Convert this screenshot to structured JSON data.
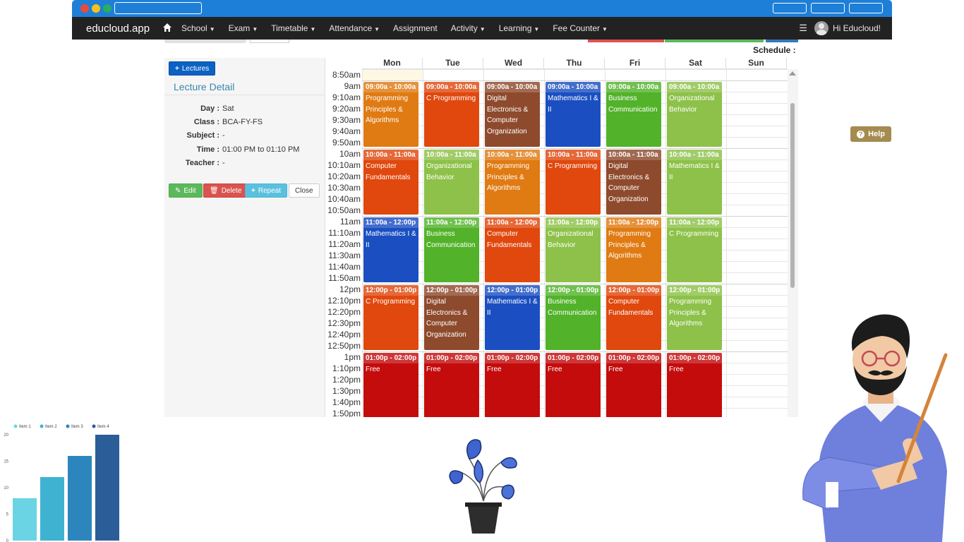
{
  "app": {
    "brand": "educloud.app",
    "nav": [
      {
        "label": "School",
        "dropdown": true
      },
      {
        "label": "Exam",
        "dropdown": true
      },
      {
        "label": "Timetable",
        "dropdown": true
      },
      {
        "label": "Attendance",
        "dropdown": true
      },
      {
        "label": "Assignment",
        "dropdown": false
      },
      {
        "label": "Activity",
        "dropdown": true
      },
      {
        "label": "Learning",
        "dropdown": true
      },
      {
        "label": "Fee Counter",
        "dropdown": true
      }
    ],
    "user_greeting": "Hi Educloud!"
  },
  "page": {
    "schedule_label": "Schedule :",
    "lectures_button": "Lectures",
    "detail_title": "Lecture Detail",
    "detail": [
      {
        "label": "Day :",
        "value": "Sat"
      },
      {
        "label": "Class :",
        "value": "BCA-FY-FS"
      },
      {
        "label": "Subject :",
        "value": "-"
      },
      {
        "label": "Time :",
        "value": "01:00 PM to 01:10 PM"
      },
      {
        "label": "Teacher :",
        "value": "-"
      }
    ],
    "buttons": {
      "edit": "Edit",
      "delete": "Delete",
      "repeat": "Repeat",
      "close": "Close"
    },
    "help": "Help"
  },
  "calendar": {
    "days": [
      "Mon",
      "Tue",
      "Wed",
      "Thu",
      "Fri",
      "Sat",
      "Sun"
    ],
    "times": [
      "8:50am",
      "9am",
      "9:10am",
      "9:20am",
      "9:30am",
      "9:40am",
      "9:50am",
      "10am",
      "10:10am",
      "10:20am",
      "10:30am",
      "10:40am",
      "10:50am",
      "11am",
      "11:10am",
      "11:20am",
      "11:30am",
      "11:40am",
      "11:50am",
      "12pm",
      "12:10pm",
      "12:20pm",
      "12:30pm",
      "12:40pm",
      "12:50pm",
      "1pm",
      "1:10pm",
      "1:20pm",
      "1:30pm",
      "1:40pm",
      "1:50pm"
    ],
    "slot_times": [
      "09:00a - 10:00a",
      "10:00a - 11:00a",
      "11:00a - 12:00p",
      "12:00p - 01:00p",
      "01:00p - 02:00p"
    ],
    "events": [
      {
        "day": 0,
        "slot": 0,
        "title": "Programming Principles & Algorithms",
        "color": "#e07a12"
      },
      {
        "day": 1,
        "slot": 0,
        "title": "C Programming",
        "color": "#e0480e"
      },
      {
        "day": 2,
        "slot": 0,
        "title": "Digital Electronics & Computer Organization",
        "color": "#8e4a2c"
      },
      {
        "day": 3,
        "slot": 0,
        "title": "Mathematics I & II",
        "color": "#1b4fc1"
      },
      {
        "day": 4,
        "slot": 0,
        "title": "Business Communication",
        "color": "#52b22a"
      },
      {
        "day": 5,
        "slot": 0,
        "title": "Organizational Behavior",
        "color": "#8dc149"
      },
      {
        "day": 0,
        "slot": 1,
        "title": "Computer Fundamentals",
        "color": "#e0480e"
      },
      {
        "day": 1,
        "slot": 1,
        "title": "Organizational Behavior",
        "color": "#8dc149"
      },
      {
        "day": 2,
        "slot": 1,
        "title": "Programming Principles & Algorithms",
        "color": "#e07a12"
      },
      {
        "day": 3,
        "slot": 1,
        "title": "C Programming",
        "color": "#e0480e"
      },
      {
        "day": 4,
        "slot": 1,
        "title": "Digital Electronics & Computer Organization",
        "color": "#8e4a2c"
      },
      {
        "day": 5,
        "slot": 1,
        "title": "Mathematics I & II",
        "color": "#8dc149"
      },
      {
        "day": 0,
        "slot": 2,
        "title": "Mathematics I & II",
        "color": "#1b4fc1"
      },
      {
        "day": 1,
        "slot": 2,
        "title": "Business Communication",
        "color": "#52b22a"
      },
      {
        "day": 2,
        "slot": 2,
        "title": "Computer Fundamentals",
        "color": "#e0480e"
      },
      {
        "day": 3,
        "slot": 2,
        "title": "Organizational Behavior",
        "color": "#8dc149"
      },
      {
        "day": 4,
        "slot": 2,
        "title": "Programming Principles & Algorithms",
        "color": "#e07a12"
      },
      {
        "day": 5,
        "slot": 2,
        "title": "C Programming",
        "color": "#8dc149"
      },
      {
        "day": 0,
        "slot": 3,
        "title": "C Programming",
        "color": "#e0480e"
      },
      {
        "day": 1,
        "slot": 3,
        "title": "Digital Electronics & Computer Organization",
        "color": "#8e4a2c"
      },
      {
        "day": 2,
        "slot": 3,
        "title": "Mathematics I & II",
        "color": "#1b4fc1"
      },
      {
        "day": 3,
        "slot": 3,
        "title": "Business Communication",
        "color": "#52b22a"
      },
      {
        "day": 4,
        "slot": 3,
        "title": "Computer Fundamentals",
        "color": "#e0480e"
      },
      {
        "day": 5,
        "slot": 3,
        "title": "Programming Principles & Algorithms",
        "color": "#8dc149"
      },
      {
        "day": 0,
        "slot": 4,
        "title": "Free",
        "color": "#c40c0c"
      },
      {
        "day": 1,
        "slot": 4,
        "title": "Free",
        "color": "#c40c0c"
      },
      {
        "day": 2,
        "slot": 4,
        "title": "Free",
        "color": "#c40c0c"
      },
      {
        "day": 3,
        "slot": 4,
        "title": "Free",
        "color": "#c40c0c"
      },
      {
        "day": 4,
        "slot": 4,
        "title": "Free",
        "color": "#c40c0c"
      },
      {
        "day": 5,
        "slot": 4,
        "title": "Free",
        "color": "#c40c0c"
      }
    ]
  },
  "chart_data": {
    "type": "bar",
    "categories": [
      "Item 1",
      "Item 2",
      "Item 3",
      "Item 4"
    ],
    "series": [
      {
        "name": "Item 1",
        "value": 8,
        "color": "#6ad4e4"
      },
      {
        "name": "Item 2",
        "value": 12,
        "color": "#3fb2d2"
      },
      {
        "name": "Item 3",
        "value": 16,
        "color": "#2c86bd"
      },
      {
        "name": "Item 4",
        "value": 20,
        "color": "#2b5e98"
      }
    ],
    "yticks": [
      "0",
      "5",
      "10",
      "15",
      "20"
    ],
    "ylim": [
      0,
      20
    ],
    "legend": "top",
    "grid": false
  }
}
